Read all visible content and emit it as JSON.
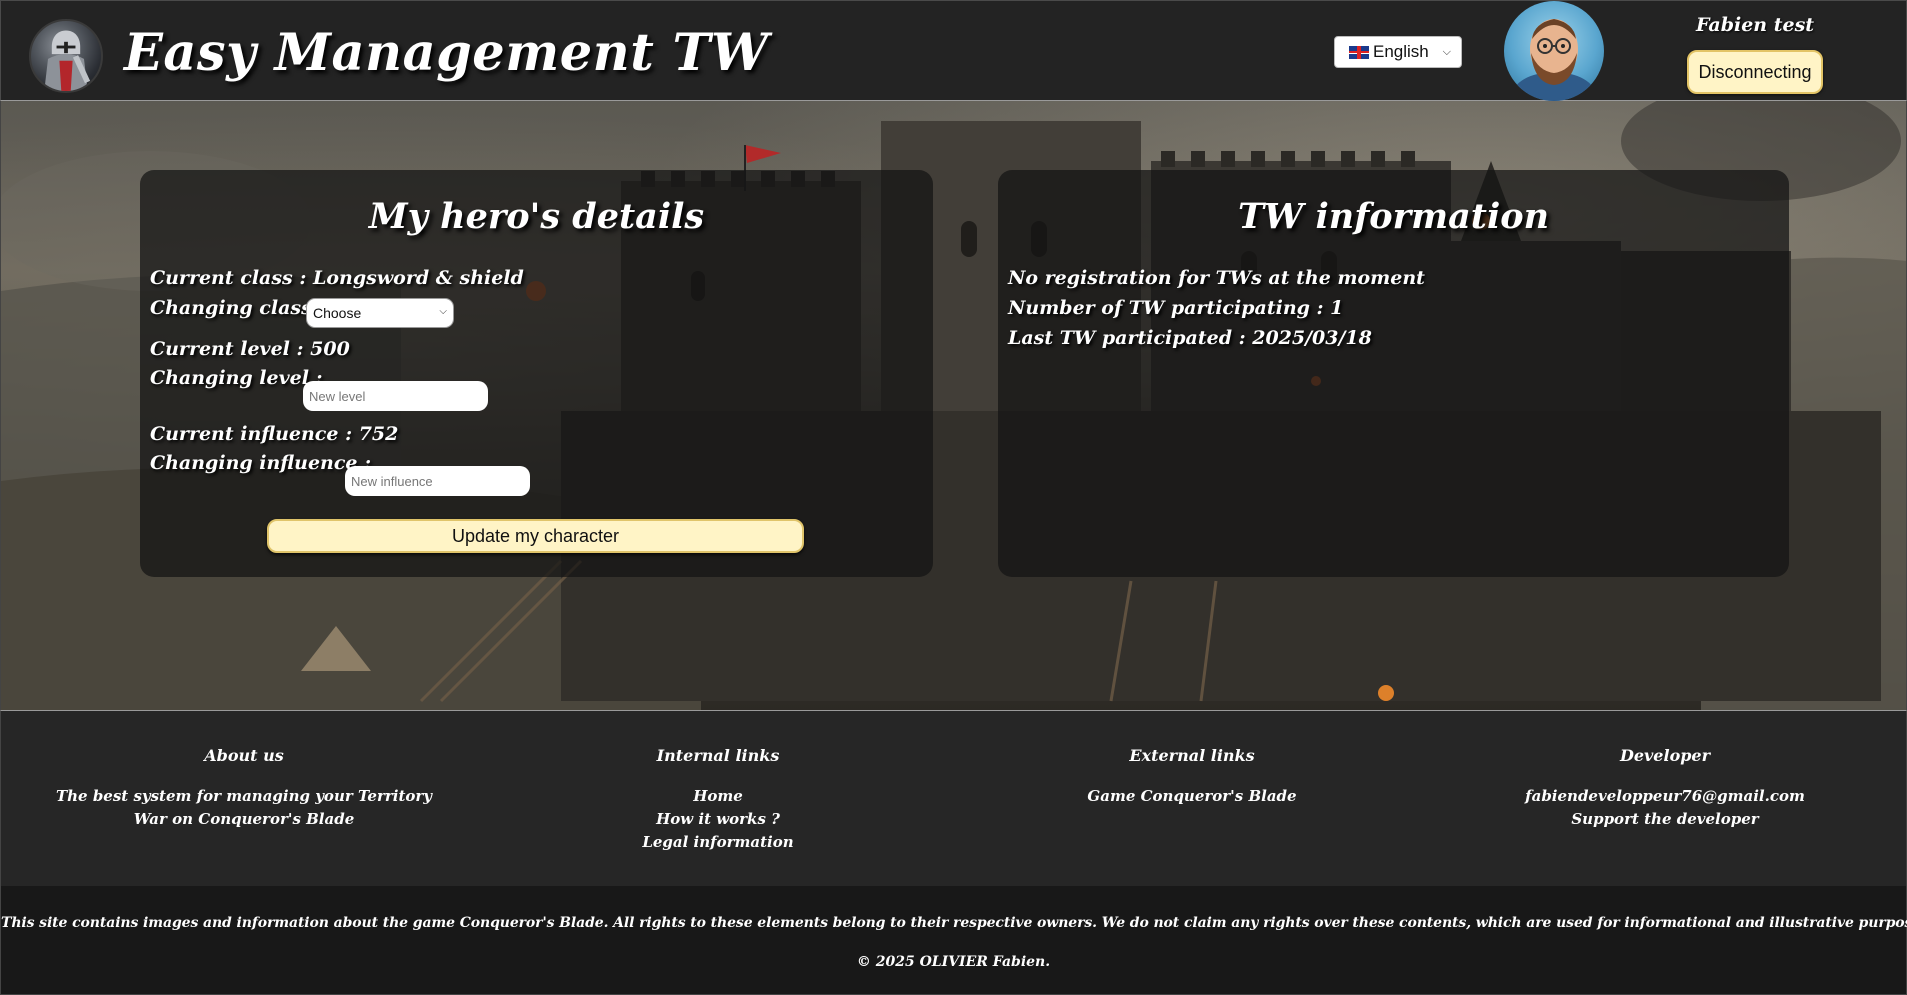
{
  "header": {
    "app_title": "Easy Management TW",
    "language": {
      "selected": "English",
      "flag": "uk-flag-icon"
    },
    "user_name": "Fabien test",
    "disconnect_label": "Disconnecting"
  },
  "hero_panel": {
    "title": "My hero's details",
    "current_class": "Current class : Longsword & shield",
    "changing_class_label": "Changing class :",
    "class_select_value": "Choose",
    "current_level": "Current level : 500",
    "changing_level_label": "Changing level :",
    "level_placeholder": "New level",
    "current_influence": "Current influence : 752",
    "changing_influence_label": "Changing influence :",
    "influence_placeholder": "New influence",
    "update_button": "Update my character"
  },
  "tw_panel": {
    "title": "TW information",
    "registration": "No registration for TWs at the moment",
    "participating": "Number of TW participating : 1",
    "last_participated": "Last TW participated : 2025/03/18"
  },
  "footer": {
    "about": {
      "heading": "About us",
      "text": "The best system for managing your Territory War on Conqueror's Blade"
    },
    "internal_links": {
      "heading": "Internal links",
      "items": [
        "Home",
        "How it works ?",
        "Legal information"
      ]
    },
    "external_links": {
      "heading": "External links",
      "items": [
        "Game Conqueror's Blade"
      ]
    },
    "developer": {
      "heading": "Developer",
      "items": [
        "fabiendeveloppeur76@gmail.com",
        "Support the developer"
      ]
    }
  },
  "legal": {
    "disclaimer": "This site contains images and information about the game Conqueror's Blade. All rights to these elements belong to their respective owners. We do not claim any rights over these contents, which are used for informational and illustrative purposes only.",
    "copyright": "© 2025 OLIVIER Fabien."
  },
  "colors": {
    "header_bg": "#232323",
    "button_bg": "#fff4c6",
    "button_border": "#e0c46a",
    "footer_bg": "#262626",
    "bottom_bg": "#181818"
  }
}
